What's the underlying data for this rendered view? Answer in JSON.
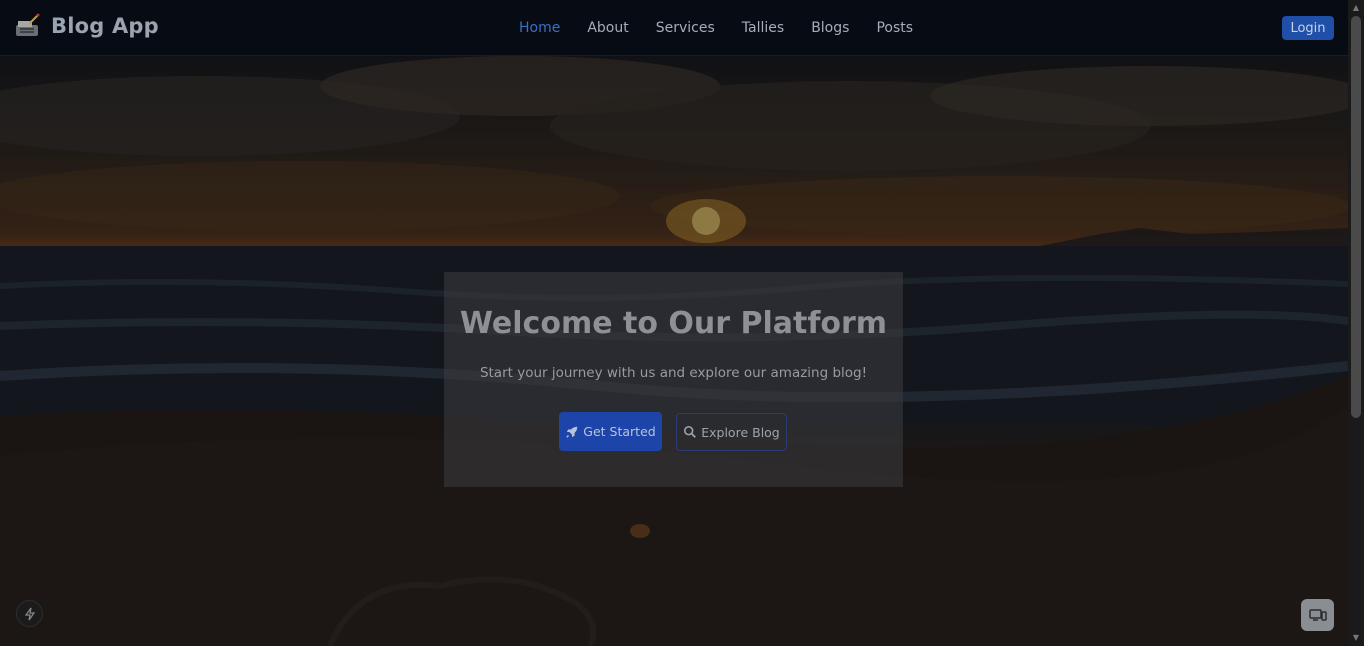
{
  "navbar": {
    "brand": "Blog App",
    "brand_icon": "typewriter-icon",
    "links": [
      {
        "label": "Home",
        "active": true
      },
      {
        "label": "About",
        "active": false
      },
      {
        "label": "Services",
        "active": false
      },
      {
        "label": "Tallies",
        "active": false
      },
      {
        "label": "Blogs",
        "active": false
      },
      {
        "label": "Posts",
        "active": false
      }
    ],
    "login_label": "Login"
  },
  "hero": {
    "title": "Welcome to Our Platform",
    "subtitle": "Start your journey with us and explore our amazing blog!",
    "primary_button": {
      "label": "Get Started",
      "icon": "rocket-icon"
    },
    "secondary_button": {
      "label": "Explore Blog",
      "icon": "search-icon"
    }
  },
  "widgets": {
    "dev_indicator_icon": "lightning-icon",
    "device_toggle_icon": "devices-icon"
  },
  "colors": {
    "accent": "#1f4fa8",
    "active_link": "#3b6fc5",
    "navbar_bg": "#060b14"
  }
}
